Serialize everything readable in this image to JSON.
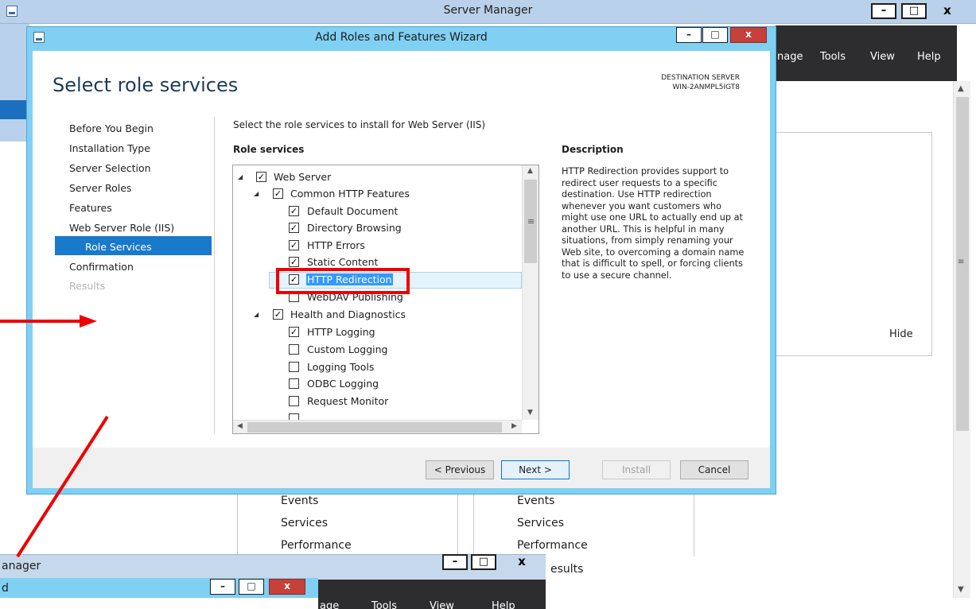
{
  "server_manager": {
    "title": "Server Manager",
    "menu": [
      "nage",
      "Tools",
      "View",
      "Help"
    ],
    "hide_label": "Hide",
    "tiles_left": [
      "Events",
      "Services",
      "Performance"
    ],
    "tiles_right": [
      "Events",
      "Services",
      "Performance",
      "esults"
    ],
    "controls": {
      "minimize": "–",
      "maximize": "□",
      "close": "x"
    }
  },
  "second_window": {
    "title": "anager",
    "subtitle": "d",
    "menu": [
      "age",
      "Tools",
      "View",
      "Help"
    ]
  },
  "wizard": {
    "title": "Add Roles and Features Wizard",
    "page_title": "Select role services",
    "destination_label": "DESTINATION SERVER",
    "destination_server": "WIN-2ANMPL5IGT8",
    "nav": [
      {
        "label": "Before You Begin",
        "state": "normal"
      },
      {
        "label": "Installation Type",
        "state": "normal"
      },
      {
        "label": "Server Selection",
        "state": "normal"
      },
      {
        "label": "Server Roles",
        "state": "normal"
      },
      {
        "label": "Features",
        "state": "normal"
      },
      {
        "label": "Web Server Role (IIS)",
        "state": "normal"
      },
      {
        "label": "Role Services",
        "state": "selected"
      },
      {
        "label": "Confirmation",
        "state": "normal"
      },
      {
        "label": "Results",
        "state": "disabled"
      }
    ],
    "instruction": "Select the role services to install for Web Server (IIS)",
    "role_services_heading": "Role services",
    "description_heading": "Description",
    "description": "HTTP Redirection provides support to redirect user requests to a specific destination. Use HTTP redirection whenever you want customers who might use one URL to actually end up at another URL. This is helpful in many situations, from simply renaming your Web site, to overcoming a domain name that is difficult to spell, or forcing clients to use a secure channel.",
    "tree": [
      {
        "label": "Web Server",
        "level": 0,
        "checked": true,
        "expander": true
      },
      {
        "label": "Common HTTP Features",
        "level": 1,
        "checked": true,
        "expander": true
      },
      {
        "label": "Default Document",
        "level": 2,
        "checked": true
      },
      {
        "label": "Directory Browsing",
        "level": 2,
        "checked": true
      },
      {
        "label": "HTTP Errors",
        "level": 2,
        "checked": true
      },
      {
        "label": "Static Content",
        "level": 2,
        "checked": true
      },
      {
        "label": "HTTP Redirection",
        "level": 2,
        "checked": true,
        "selected": true
      },
      {
        "label": "WebDAV Publishing",
        "level": 2,
        "checked": false
      },
      {
        "label": "Health and Diagnostics",
        "level": 1,
        "checked": true,
        "expander": true
      },
      {
        "label": "HTTP Logging",
        "level": 2,
        "checked": true
      },
      {
        "label": "Custom Logging",
        "level": 2,
        "checked": false
      },
      {
        "label": "Logging Tools",
        "level": 2,
        "checked": false
      },
      {
        "label": "ODBC Logging",
        "level": 2,
        "checked": false
      },
      {
        "label": "Request Monitor",
        "level": 2,
        "checked": false
      }
    ],
    "buttons": {
      "previous": "< Previous",
      "next": "Next >",
      "install": "Install",
      "cancel": "Cancel"
    },
    "colors": {
      "accent": "#1979ca",
      "frame": "#7fd0f3",
      "annotation": "#ee0000"
    }
  }
}
